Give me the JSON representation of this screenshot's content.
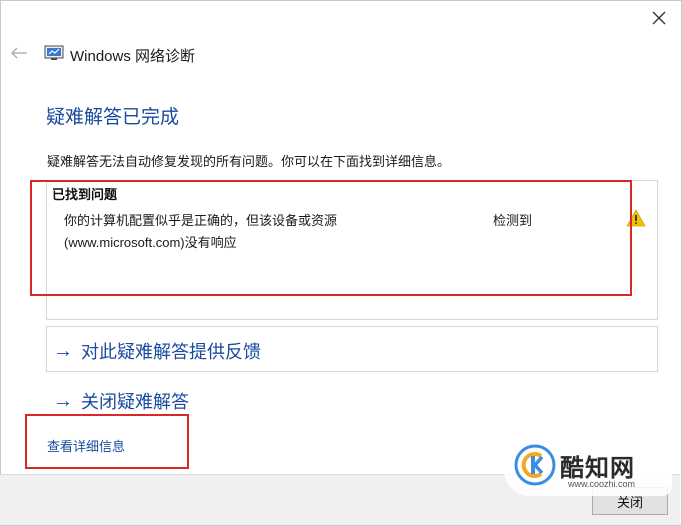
{
  "window": {
    "title": "Windows 网络诊断",
    "close_icon": "close-icon",
    "back_icon": "back-arrow-icon"
  },
  "main": {
    "heading": "疑难解答已完成",
    "description": "疑难解答无法自动修复发现的所有问题。你可以在下面找到详细信息。",
    "problems": {
      "header": "已找到问题",
      "items": [
        {
          "text_line1": "你的计算机配置似乎是正确的，但该设备或资源",
          "text_line2": "(www.microsoft.com)没有响应",
          "status": "检测到",
          "icon": "warning-icon"
        }
      ]
    },
    "links": {
      "feedback": "对此疑难解答提供反馈",
      "close_troubleshooter": "关闭疑难解答",
      "details": "查看详细信息"
    }
  },
  "footer": {
    "close_label": "关闭"
  },
  "watermark": {
    "name": "酷知网",
    "url": "www.coozhi.com"
  },
  "colors": {
    "accent": "#1a4a9e",
    "highlight_box": "#d8282a",
    "warning": "#f2c200"
  }
}
